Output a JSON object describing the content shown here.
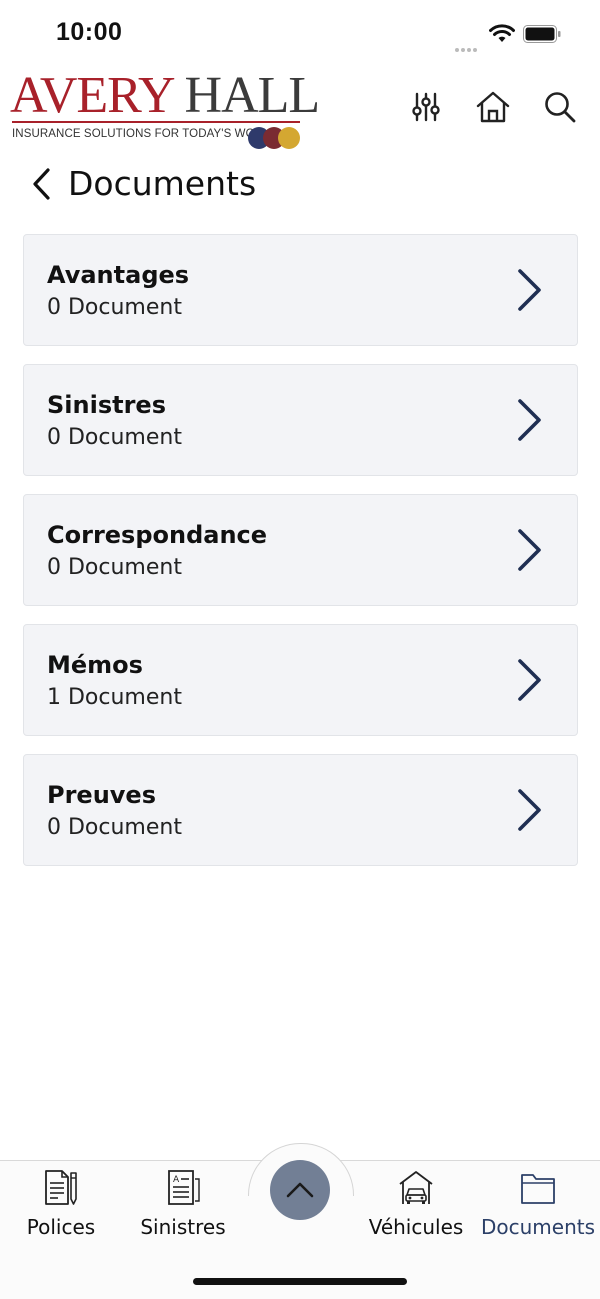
{
  "status_bar": {
    "time": "10:00"
  },
  "brand": {
    "name_part1": "AVERY",
    "name_part2": "HALL",
    "tagline": "INSURANCE SOLUTIONS FOR TODAY'S WORLD",
    "colors": {
      "red": "#a8212a",
      "dark": "#3b3b3b",
      "navy": "#2e3a6b",
      "maroon": "#7a2b32",
      "gold": "#d4a731"
    }
  },
  "header": {
    "icons": [
      "sliders-icon",
      "home-icon",
      "search-icon"
    ]
  },
  "page": {
    "title": "Documents"
  },
  "documents": [
    {
      "name": "Avantages",
      "count": "0 Document"
    },
    {
      "name": "Sinistres",
      "count": "0 Document"
    },
    {
      "name": "Correspondance",
      "count": "0 Document"
    },
    {
      "name": "Mémos",
      "count": "1 Document"
    },
    {
      "name": "Preuves",
      "count": "0 Document"
    }
  ],
  "bottom_nav": {
    "items": [
      {
        "label": "Polices",
        "icon": "policy-document-icon"
      },
      {
        "label": "Sinistres",
        "icon": "claim-form-icon"
      },
      {
        "label": "Véhicules",
        "icon": "car-garage-icon"
      },
      {
        "label": "Documents",
        "icon": "folder-icon",
        "active": true
      }
    ],
    "fab_icon": "chevron-up-icon"
  },
  "colors": {
    "accent": "#2c4068",
    "chevron": "#1f2f52",
    "card_bg": "#f3f4f7",
    "fab_bg": "#727f95"
  }
}
